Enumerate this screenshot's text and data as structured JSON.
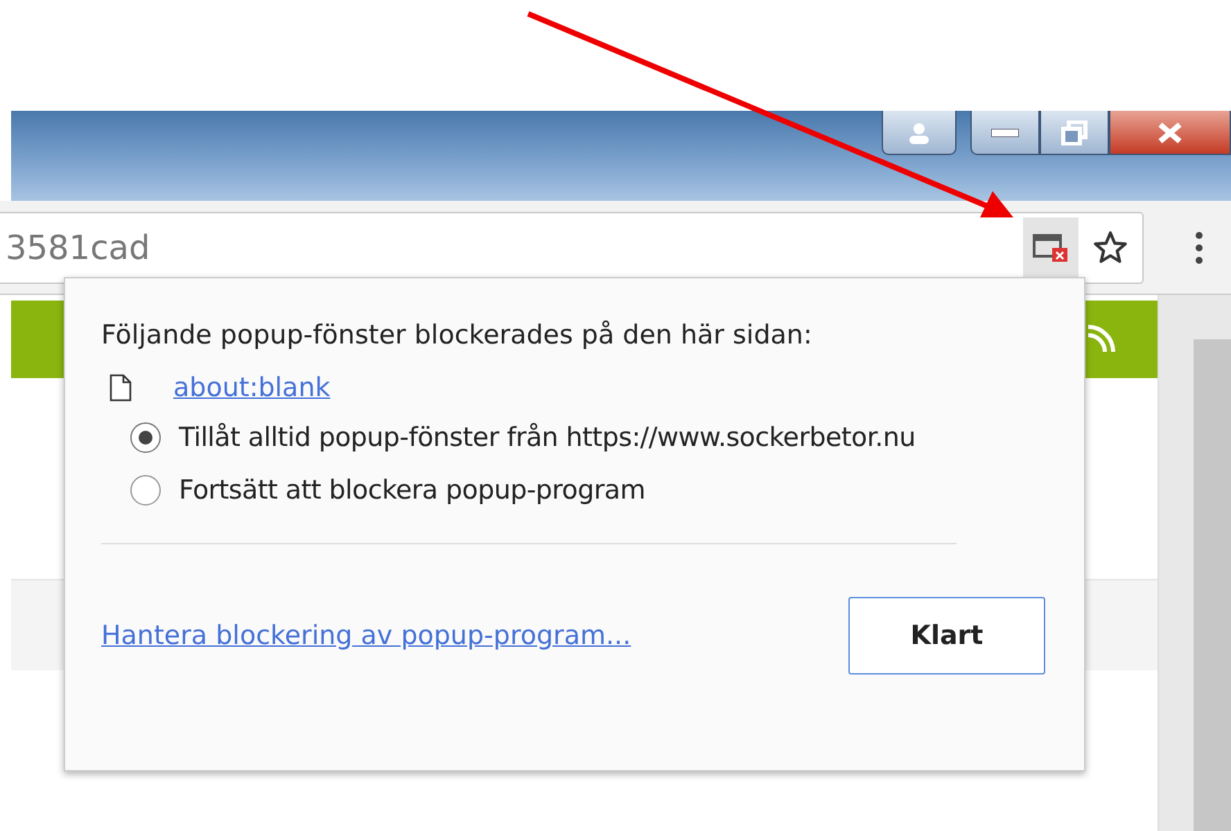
{
  "address_bar": {
    "url": "3581cad",
    "popup_blocked_indicator": true
  },
  "popup": {
    "heading": "Följande popup-fönster blockerades på den här sidan:",
    "blocked_items": [
      {
        "link": "about:blank"
      }
    ],
    "options": [
      {
        "label": "Tillåt alltid popup-fönster från https://www.sockerbetor.nu",
        "selected": true
      },
      {
        "label": "Fortsätt att blockera popup-program",
        "selected": false
      }
    ],
    "manage_link": "Hantera blockering av popup-program...",
    "done_button": "Klart"
  }
}
